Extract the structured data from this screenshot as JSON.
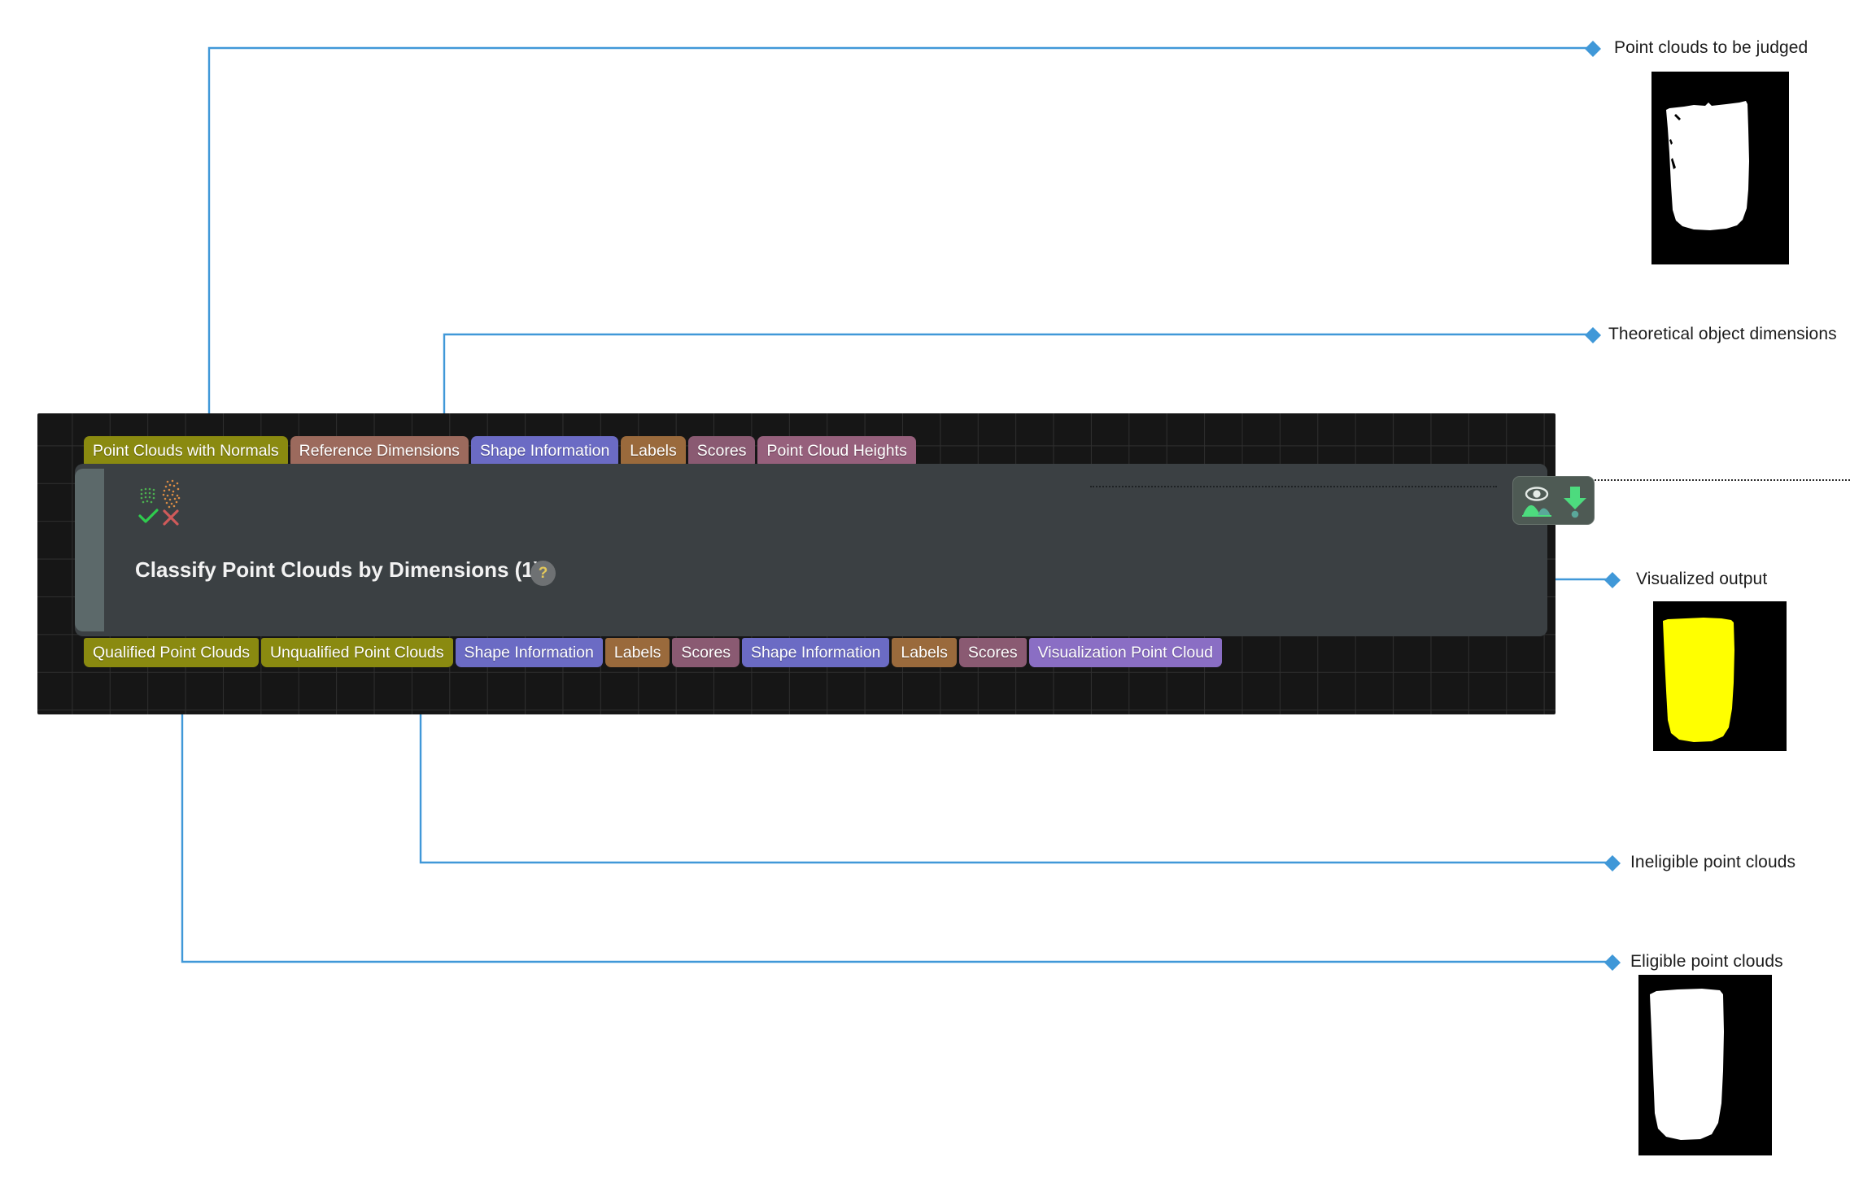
{
  "graph": {
    "node": {
      "title": "Classify Point Clouds by Dimensions (1)",
      "help_badge": "?",
      "icon_name": "classify-point-clouds-icon",
      "actions": [
        {
          "name": "visualize-output-button",
          "icon": "eye-image-icon"
        },
        {
          "name": "download-output-button",
          "icon": "download-arrow-icon"
        }
      ]
    },
    "input_ports": [
      {
        "label": "Point Clouds with Normals",
        "color": "#8a8a10"
      },
      {
        "label": "Reference Dimensions",
        "color": "#9c6a5d"
      },
      {
        "label": "Shape Information",
        "color": "#6b6bc4"
      },
      {
        "label": "Labels",
        "color": "#9a6a3c"
      },
      {
        "label": "Scores",
        "color": "#8a5a72"
      },
      {
        "label": "Point Cloud Heights",
        "color": "#96607c"
      }
    ],
    "output_ports": [
      {
        "label": "Qualified Point Clouds",
        "color": "#8a8a10"
      },
      {
        "label": "Unqualified Point Clouds",
        "color": "#8a8a10"
      },
      {
        "label": "Shape Information",
        "color": "#6b6bc4"
      },
      {
        "label": "Labels",
        "color": "#9a6a3c"
      },
      {
        "label": "Scores",
        "color": "#8a5a72"
      },
      {
        "label": "Shape Information",
        "color": "#6b6bc4"
      },
      {
        "label": "Labels",
        "color": "#9a6a3c"
      },
      {
        "label": "Scores",
        "color": "#8a5a72"
      },
      {
        "label": "Visualization Point Cloud",
        "color": "#8a6ec4"
      }
    ]
  },
  "callouts": [
    {
      "id": "point-clouds-to-be-judged",
      "label": "Point clouds to be judged"
    },
    {
      "id": "theoretical-object-dimensions",
      "label": "Theoretical object dimensions"
    },
    {
      "id": "visualized-output",
      "label": "Visualized output"
    },
    {
      "id": "ineligible-point-clouds",
      "label": "Ineligible point clouds"
    },
    {
      "id": "eligible-point-clouds",
      "label": "Eligible point clouds"
    }
  ],
  "thumbnails": [
    {
      "id": "thumb-point-clouds-to-be-judged",
      "background": "#000000",
      "blob_color": "#ffffff"
    },
    {
      "id": "thumb-visualized-output",
      "background": "#000000",
      "blob_color": "#ffff00"
    },
    {
      "id": "thumb-eligible-point-clouds",
      "background": "#000000",
      "blob_color": "#ffffff"
    }
  ],
  "colors": {
    "connector": "#4098d8",
    "canvas_background": "#161616",
    "node_background": "#3b4043",
    "page_background": "#ffffff"
  }
}
